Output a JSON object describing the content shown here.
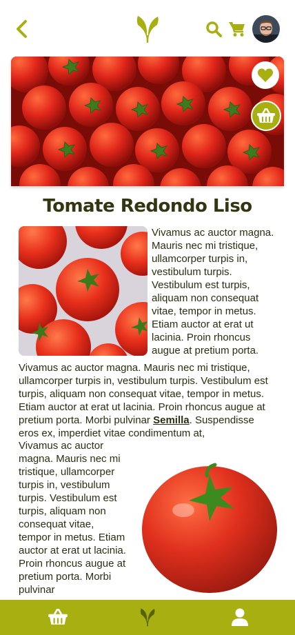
{
  "colors": {
    "accent": "#a7b010",
    "text": "#2b2e12",
    "title": "#333611"
  },
  "header": {
    "icons": [
      "chevron-left-icon",
      "leaf-logo-icon",
      "search-icon",
      "cart-icon",
      "avatar"
    ]
  },
  "product": {
    "title": "Tomate Redondo Liso",
    "intro": "Vivamus ac auctor magna. Mauris nec mi tristique, ullamcorper turpis in, vestibulum turpis. Vestibulum est turpis, aliquam non consequat vitae, tempor in metus. Etiam auctor at erat ut lacinia. Proin rhoncus augue at pretium porta.",
    "body_before_link": "Vivamus ac auctor magna. Mauris nec mi tristique, ullamcorper turpis in, vestibulum turpis. Vestibulum est turpis, aliquam non consequat vitae, tempor in metus. Etiam auctor at erat ut lacinia. Proin rhoncus augue at pretium porta. Morbi pulvinar ",
    "link_label": "Semilla",
    "body_after_link": ". Suspendisse eros ex, imperdiet vitae condimentum at,",
    "column_text": "Vivamus ac auctor magna. Mauris nec mi tristique, ullamcorper turpis in, vestibulum turpis. Vestibulum est turpis, aliquam non consequat vitae, tempor in metus. Etiam auctor at erat ut lacinia. Proin rhoncus augue at pretium porta. Morbi pulvinar"
  },
  "bottom_nav": {
    "items": [
      "basket-icon",
      "leaf-icon",
      "user-icon"
    ]
  }
}
